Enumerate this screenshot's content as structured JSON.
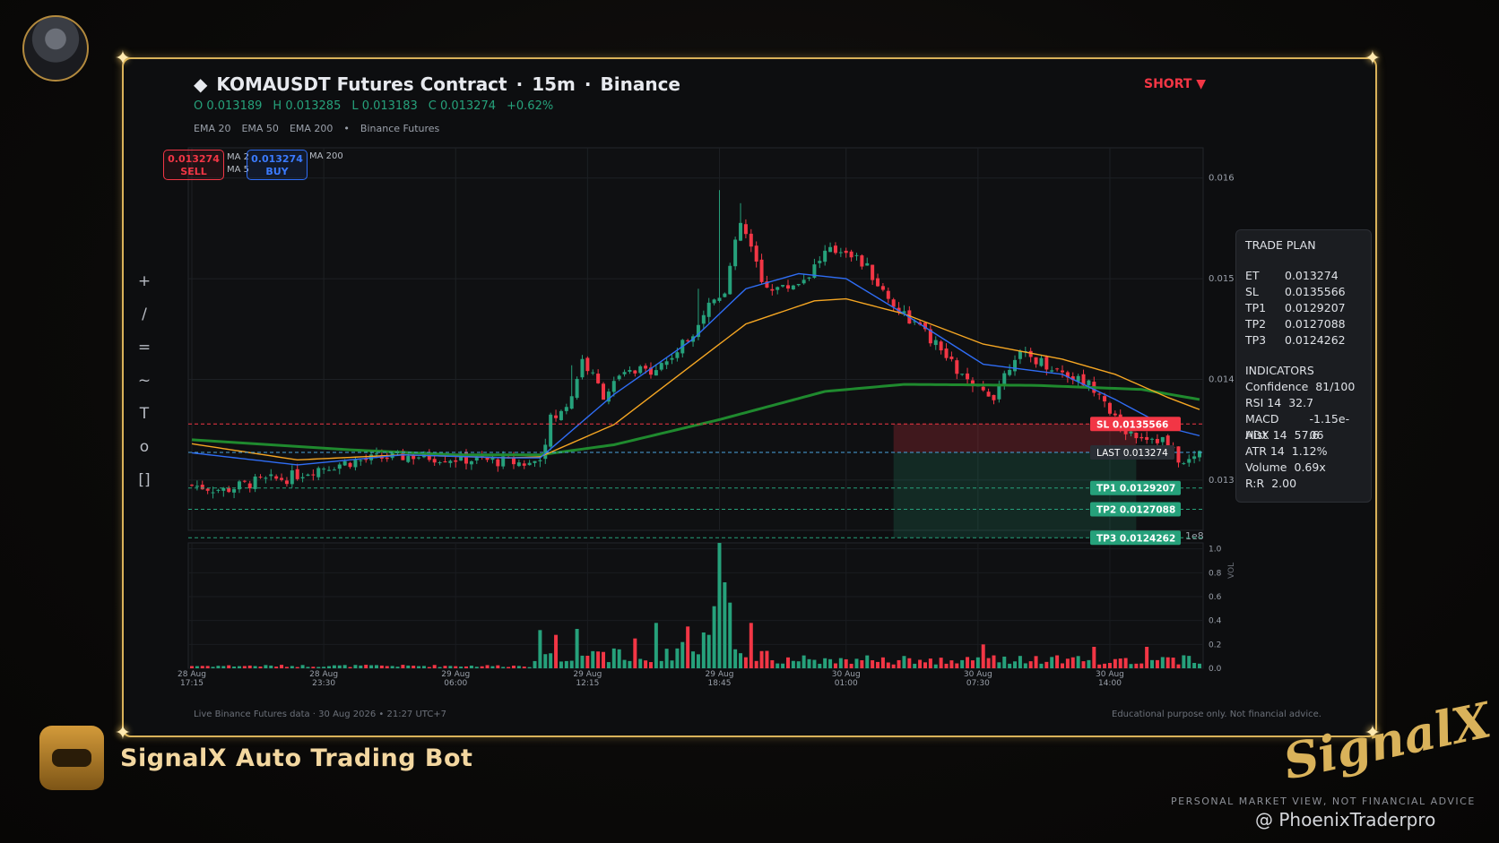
{
  "header": {
    "title": "KOMAUSDT Futures Contract",
    "interval": "15m",
    "exchange": "Binance",
    "ohlc": {
      "open": "O 0.013189",
      "high": "H 0.013285",
      "low": "L 0.013183",
      "close": "C 0.013274",
      "change": "+0.62%"
    },
    "indicators": [
      "EMA 20",
      "EMA 50",
      "EMA 200"
    ],
    "source": "Binance Futures",
    "direction": "SHORT"
  },
  "overlay_buttons": {
    "sell_price": "0.013274",
    "sell_label": "SELL",
    "buy_price": "0.013274",
    "buy_label": "BUY",
    "legend_hidden_1": "MA 2",
    "legend_hidden_2": "MA 5",
    "legend_visible": "MA 200"
  },
  "tools": [
    "+",
    "/",
    "=",
    "~",
    "T",
    "o",
    "[]"
  ],
  "trade_plan": {
    "title": "TRADE PLAN",
    "levels": [
      {
        "k": "ET",
        "v": "0.013274"
      },
      {
        "k": "SL",
        "v": "0.0135566"
      },
      {
        "k": "TP1",
        "v": "0.0129207"
      },
      {
        "k": "TP2",
        "v": "0.0127088"
      },
      {
        "k": "TP3",
        "v": "0.0124262"
      }
    ],
    "ind_title": "INDICATORS",
    "indicators": [
      {
        "k": "Confidence",
        "v": "81/100"
      },
      {
        "k": "RSI 14",
        "v": "32.7"
      },
      {
        "k": "MACD Hist",
        "v": "-1.15e-06"
      },
      {
        "k": "ADX 14",
        "v": "57.6"
      },
      {
        "k": "ATR 14",
        "v": "1.12%"
      },
      {
        "k": "Volume",
        "v": "0.69x"
      },
      {
        "k": "R:R",
        "v": "2.00"
      }
    ]
  },
  "footer": {
    "left": "Live Binance Futures data  ·  30 Aug 2026 • 21:27 UTC+7",
    "right": "Educational purpose only. Not financial advice."
  },
  "brand": {
    "name": "SignalX Auto Trading Bot",
    "logo": "SignalX",
    "disclaimer": "PERSONAL MARKET VIEW, NOT FINANCIAL ADVICE",
    "watermark": "@ PhoenixTraderpro"
  },
  "colors": {
    "up": "#26a17b",
    "down": "#f23645",
    "ema20": "#2f6df5",
    "ema50": "#f5a623",
    "ema200": "#1f8a2e",
    "gold": "#d9b25a"
  },
  "chart_data": {
    "type": "candlestick",
    "ylim": [
      0.0125,
      0.0163
    ],
    "y_ticks": [
      0.013,
      0.014,
      0.015,
      0.016
    ],
    "y_tick_labels": [
      "0.013",
      "0.014",
      "0.015",
      "0.016"
    ],
    "y_exponent_label": "1e8",
    "x_tick_labels": [
      [
        "28 Aug",
        "17:15"
      ],
      [
        "28 Aug",
        "23:30"
      ],
      [
        "29 Aug",
        "06:00"
      ],
      [
        "29 Aug",
        "12:15"
      ],
      [
        "29 Aug",
        "18:45"
      ],
      [
        "30 Aug",
        "01:00"
      ],
      [
        "30 Aug",
        "07:30"
      ],
      [
        "30 Aug",
        "14:00"
      ]
    ],
    "x_tick_index": [
      0,
      25,
      50,
      75,
      100,
      124,
      149,
      174
    ],
    "close_path": [
      [
        0,
        0.01295
      ],
      [
        6,
        0.0129
      ],
      [
        12,
        0.01298
      ],
      [
        18,
        0.01302
      ],
      [
        24,
        0.01312
      ],
      [
        30,
        0.01318
      ],
      [
        36,
        0.01322
      ],
      [
        42,
        0.01324
      ],
      [
        48,
        0.01322
      ],
      [
        54,
        0.0132
      ],
      [
        60,
        0.01318
      ],
      [
        64,
        0.01316
      ],
      [
        66,
        0.01322
      ],
      [
        68,
        0.0136
      ],
      [
        70,
        0.01366
      ],
      [
        72,
        0.01385
      ],
      [
        74,
        0.0142
      ],
      [
        78,
        0.01385
      ],
      [
        82,
        0.01405
      ],
      [
        86,
        0.01408
      ],
      [
        90,
        0.01418
      ],
      [
        94,
        0.0144
      ],
      [
        98,
        0.01475
      ],
      [
        101,
        0.0149
      ],
      [
        104,
        0.01555
      ],
      [
        106,
        0.0153
      ],
      [
        108,
        0.01495
      ],
      [
        112,
        0.0149
      ],
      [
        116,
        0.015
      ],
      [
        120,
        0.01525
      ],
      [
        124,
        0.0153
      ],
      [
        128,
        0.0151
      ],
      [
        132,
        0.0148
      ],
      [
        136,
        0.0146
      ],
      [
        140,
        0.0144
      ],
      [
        144,
        0.01415
      ],
      [
        148,
        0.0139
      ],
      [
        152,
        0.01385
      ],
      [
        156,
        0.01425
      ],
      [
        160,
        0.0142
      ],
      [
        164,
        0.0141
      ],
      [
        168,
        0.014
      ],
      [
        172,
        0.0139
      ],
      [
        176,
        0.0135
      ],
      [
        180,
        0.01345
      ],
      [
        184,
        0.0134
      ],
      [
        188,
        0.01315
      ],
      [
        191,
        0.01327
      ]
    ],
    "spike_highs": [
      [
        100,
        0.01588
      ],
      [
        104,
        0.01575
      ],
      [
        72,
        0.01414
      ],
      [
        96,
        0.0149
      ]
    ],
    "ema20": [
      [
        0,
        0.01327
      ],
      [
        20,
        0.01315
      ],
      [
        40,
        0.01325
      ],
      [
        60,
        0.01322
      ],
      [
        66,
        0.01322
      ],
      [
        80,
        0.01385
      ],
      [
        95,
        0.0144
      ],
      [
        105,
        0.0149
      ],
      [
        115,
        0.01505
      ],
      [
        124,
        0.015
      ],
      [
        135,
        0.01465
      ],
      [
        150,
        0.01415
      ],
      [
        165,
        0.01405
      ],
      [
        175,
        0.0138
      ],
      [
        185,
        0.01352
      ],
      [
        191,
        0.01344
      ]
    ],
    "ema50": [
      [
        0,
        0.01336
      ],
      [
        20,
        0.0132
      ],
      [
        40,
        0.01325
      ],
      [
        60,
        0.01322
      ],
      [
        66,
        0.01323
      ],
      [
        80,
        0.01355
      ],
      [
        95,
        0.01415
      ],
      [
        105,
        0.01455
      ],
      [
        118,
        0.01478
      ],
      [
        124,
        0.0148
      ],
      [
        135,
        0.01465
      ],
      [
        150,
        0.01435
      ],
      [
        165,
        0.0142
      ],
      [
        175,
        0.01405
      ],
      [
        185,
        0.01382
      ],
      [
        191,
        0.0137
      ]
    ],
    "ema200": [
      [
        0,
        0.0134
      ],
      [
        30,
        0.0133
      ],
      [
        50,
        0.01325
      ],
      [
        66,
        0.01325
      ],
      [
        80,
        0.01335
      ],
      [
        100,
        0.0136
      ],
      [
        120,
        0.01388
      ],
      [
        135,
        0.01395
      ],
      [
        160,
        0.01394
      ],
      [
        180,
        0.0139
      ],
      [
        191,
        0.0138
      ]
    ],
    "levels": [
      {
        "name": "SL",
        "value": 0.0135566,
        "label": "SL  0.0135566",
        "color": "#f23645"
      },
      {
        "name": "LAST",
        "value": 0.013274,
        "label": "LAST  0.013274",
        "color": "#4aa3df"
      },
      {
        "name": "TP1",
        "value": 0.0129207,
        "label": "TP1  0.0129207",
        "color": "#26a17b"
      },
      {
        "name": "TP2",
        "value": 0.0127088,
        "label": "TP2  0.0127088",
        "color": "#26a17b"
      },
      {
        "name": "TP3",
        "value": 0.0124262,
        "label": "TP3  0.0124262",
        "color": "#26a17b"
      }
    ],
    "trade_box": {
      "x_start": 133,
      "x_end": 179,
      "entry": 0.013274,
      "stop": 0.0135566,
      "target": 0.0124262
    },
    "volume": {
      "ylim": [
        0,
        1.05
      ],
      "y_ticks": [
        0,
        0.2,
        0.4,
        0.6,
        0.8,
        1.0
      ],
      "y_tick_labels": [
        "0.0",
        "0.2",
        "0.4",
        "0.6",
        "0.8",
        "1.0"
      ],
      "ylabel": "VOL",
      "spikes": [
        [
          66,
          0.32
        ],
        [
          69,
          0.28
        ],
        [
          73,
          0.33
        ],
        [
          88,
          0.38
        ],
        [
          93,
          0.22
        ],
        [
          98,
          0.28
        ],
        [
          99,
          0.52
        ],
        [
          100,
          1.05
        ],
        [
          101,
          0.72
        ],
        [
          102,
          0.55
        ],
        [
          94,
          0.35
        ],
        [
          97,
          0.3
        ],
        [
          106,
          0.38
        ],
        [
          84,
          0.25
        ],
        [
          150,
          0.2
        ],
        [
          171,
          0.18
        ],
        [
          181,
          0.18
        ]
      ]
    }
  }
}
